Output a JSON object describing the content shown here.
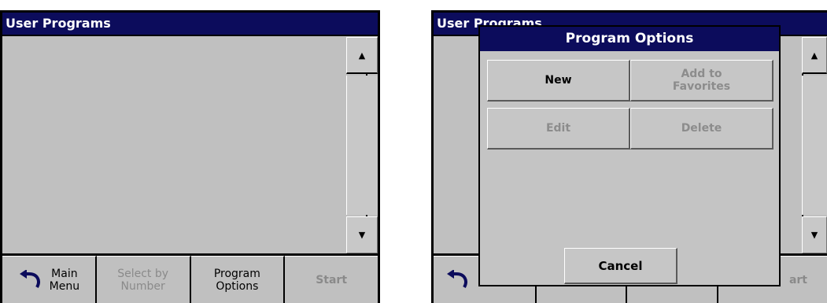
{
  "left": {
    "title": "User Programs",
    "scroll_up": "▲",
    "scroll_down": "▼",
    "bottom_bar": {
      "main_menu": "Main\nMenu",
      "select_by_number": "Select by\nNumber",
      "program_options": "Program\nOptions",
      "start": "Start"
    }
  },
  "right": {
    "title": "User Programs",
    "scroll_up": "▲",
    "scroll_down": "▼",
    "start_partial": "art",
    "dialog": {
      "title": "Program Options",
      "new": "New",
      "add_to_favorites": "Add to\nFavorites",
      "edit": "Edit",
      "delete": "Delete",
      "cancel": "Cancel"
    }
  },
  "colors": {
    "titlebar": "#0c0c5c",
    "panel": "#c0c0c0",
    "disabled_text": "#8a8a8a"
  },
  "icons": {
    "back": "back-arrow-icon"
  }
}
